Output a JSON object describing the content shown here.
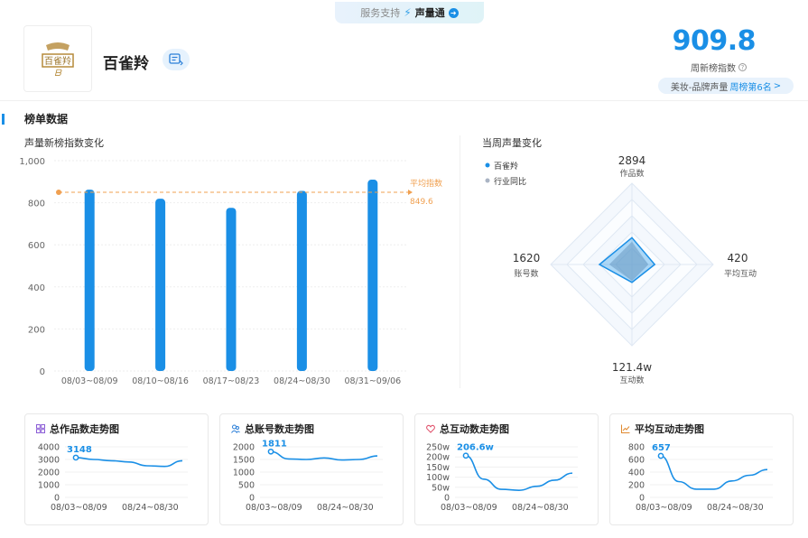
{
  "service": {
    "prefix": "服务支持",
    "name": "声量通"
  },
  "brand": {
    "name": "百雀羚",
    "logo_text": "百雀羚"
  },
  "score": {
    "value": "909.8",
    "label": "周新榜指数"
  },
  "rank": {
    "prefix": "美妆-品牌声量",
    "highlight": "周榜第6名",
    "suffix": ">"
  },
  "section": {
    "title": "榜单数据"
  },
  "bar_chart": {
    "title": "声量新榜指数变化"
  },
  "radar_chart": {
    "title": "当周声量变化",
    "legend": [
      "百雀羚",
      "行业同比"
    ],
    "axes": [
      {
        "value": "2894",
        "label": "作品数"
      },
      {
        "value": "420",
        "label": "平均互动"
      },
      {
        "value": "121.4w",
        "label": "互动数"
      },
      {
        "value": "1620",
        "label": "账号数"
      }
    ]
  },
  "mini_charts": [
    {
      "title": "总作品数走势图",
      "peak_label": "3148"
    },
    {
      "title": "总账号数走势图",
      "peak_label": "1811"
    },
    {
      "title": "总互动数走势图",
      "peak_label": "206.6w"
    },
    {
      "title": "平均互动走势图",
      "peak_label": "657"
    }
  ],
  "colors": {
    "accent": "#1a8fe6",
    "avg_line": "#f0a050",
    "brand": "#222"
  },
  "chart_data": [
    {
      "type": "bar",
      "title": "声量新榜指数变化",
      "categories": [
        "08/03~08/09",
        "08/10~08/16",
        "08/17~08/23",
        "08/24~08/30",
        "08/31~09/06"
      ],
      "values": [
        862,
        819,
        776,
        856,
        909.8
      ],
      "ylim": [
        0,
        1000
      ],
      "yticks": [
        0,
        200,
        400,
        600,
        800,
        1000
      ],
      "ytick_labels": [
        "0",
        "200",
        "400",
        "600",
        "800",
        "1,000"
      ],
      "reference_line": {
        "label": "平均指数",
        "value": 849.6,
        "value_label": "849.6"
      },
      "grid": true
    },
    {
      "type": "radar",
      "title": "当周声量变化",
      "axes": [
        "作品数",
        "平均互动",
        "互动数",
        "账号数"
      ],
      "series": [
        {
          "name": "百雀羚",
          "values": [
            0.33,
            0.28,
            0.22,
            0.4
          ]
        },
        {
          "name": "行业同比",
          "values": [
            0.28,
            0.2,
            0.2,
            0.28
          ]
        }
      ]
    },
    {
      "type": "line",
      "title": "总作品数走势图",
      "x_labels": [
        "08/03~08/09",
        "08/24~08/30"
      ],
      "x": [
        0,
        1,
        2,
        3,
        4,
        5,
        6
      ],
      "y": [
        3148,
        3000,
        2900,
        2800,
        2500,
        2450,
        2900
      ],
      "ylim": [
        0,
        4000
      ],
      "yticks": [
        "0",
        "1000",
        "2000",
        "3000",
        "4000"
      ],
      "peak": {
        "label": "3148"
      }
    },
    {
      "type": "line",
      "title": "总账号数走势图",
      "x_labels": [
        "08/03~08/09",
        "08/24~08/30"
      ],
      "x": [
        0,
        1,
        2,
        3,
        4,
        5,
        6
      ],
      "y": [
        1811,
        1520,
        1500,
        1560,
        1480,
        1500,
        1640
      ],
      "ylim": [
        0,
        2000
      ],
      "yticks": [
        "0",
        "500",
        "1000",
        "1500",
        "2000"
      ],
      "peak": {
        "label": "1811"
      }
    },
    {
      "type": "line",
      "title": "总互动数走势图",
      "x_labels": [
        "08/03~08/09",
        "08/24~08/30"
      ],
      "x": [
        0,
        1,
        2,
        3,
        4,
        5,
        6
      ],
      "y": [
        206.6,
        90,
        40,
        35,
        55,
        85,
        120
      ],
      "ylim": [
        0,
        250
      ],
      "yticks": [
        "0",
        "50w",
        "100w",
        "150w",
        "200w",
        "250w"
      ],
      "peak": {
        "label": "206.6w"
      }
    },
    {
      "type": "line",
      "title": "平均互动走势图",
      "x_labels": [
        "08/03~08/09",
        "08/24~08/30"
      ],
      "x": [
        0,
        1,
        2,
        3,
        4,
        5,
        6
      ],
      "y": [
        657,
        250,
        130,
        130,
        260,
        350,
        440
      ],
      "ylim": [
        0,
        800
      ],
      "yticks": [
        "0",
        "200",
        "400",
        "600",
        "800"
      ],
      "peak": {
        "label": "657"
      }
    }
  ]
}
